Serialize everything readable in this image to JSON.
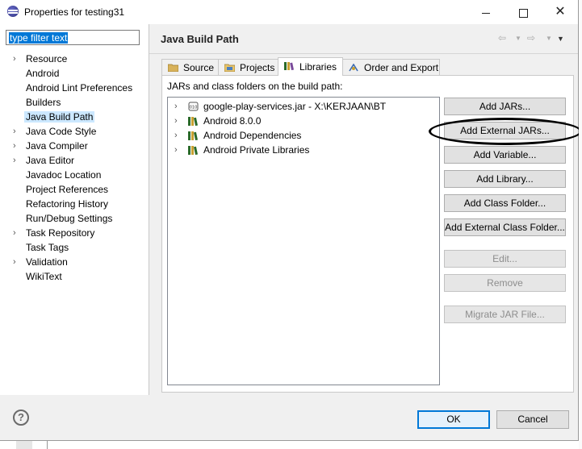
{
  "window": {
    "title": "Properties for testing31"
  },
  "filter": {
    "value": "type filter text"
  },
  "nav": [
    {
      "label": "Resource",
      "expandable": true
    },
    {
      "label": "Android",
      "expandable": false
    },
    {
      "label": "Android Lint Preferences",
      "expandable": false
    },
    {
      "label": "Builders",
      "expandable": false
    },
    {
      "label": "Java Build Path",
      "expandable": false,
      "selected": true
    },
    {
      "label": "Java Code Style",
      "expandable": true
    },
    {
      "label": "Java Compiler",
      "expandable": true
    },
    {
      "label": "Java Editor",
      "expandable": true
    },
    {
      "label": "Javadoc Location",
      "expandable": false
    },
    {
      "label": "Project References",
      "expandable": false
    },
    {
      "label": "Refactoring History",
      "expandable": false
    },
    {
      "label": "Run/Debug Settings",
      "expandable": false
    },
    {
      "label": "Task Repository",
      "expandable": true
    },
    {
      "label": "Task Tags",
      "expandable": false
    },
    {
      "label": "Validation",
      "expandable": true
    },
    {
      "label": "WikiText",
      "expandable": false
    }
  ],
  "page": {
    "title": "Java Build Path"
  },
  "tabs": [
    {
      "label": "Source",
      "icon": "source-folder-icon"
    },
    {
      "label": "Projects",
      "icon": "projects-icon"
    },
    {
      "label": "Libraries",
      "icon": "libraries-icon",
      "active": true
    },
    {
      "label": "Order and Export",
      "icon": "order-export-icon"
    }
  ],
  "libraries": {
    "label": "JARs and class folders on the build path:",
    "items": [
      {
        "label": "google-play-services.jar - X:\\KERJAAN\\BT",
        "icon": "jar-icon"
      },
      {
        "label": "Android 8.0.0",
        "icon": "library-icon"
      },
      {
        "label": "Android Dependencies",
        "icon": "library-icon"
      },
      {
        "label": "Android Private Libraries",
        "icon": "library-icon"
      }
    ]
  },
  "buttons": {
    "add_jars": "Add JARs...",
    "add_external_jars": "Add External JARs...",
    "add_variable": "Add Variable...",
    "add_library": "Add Library...",
    "add_class_folder": "Add Class Folder...",
    "add_external_class_folder": "Add External Class Folder...",
    "edit": "Edit...",
    "remove": "Remove",
    "migrate_jar": "Migrate JAR File..."
  },
  "footer": {
    "ok": "OK",
    "cancel": "Cancel",
    "help": "?"
  }
}
